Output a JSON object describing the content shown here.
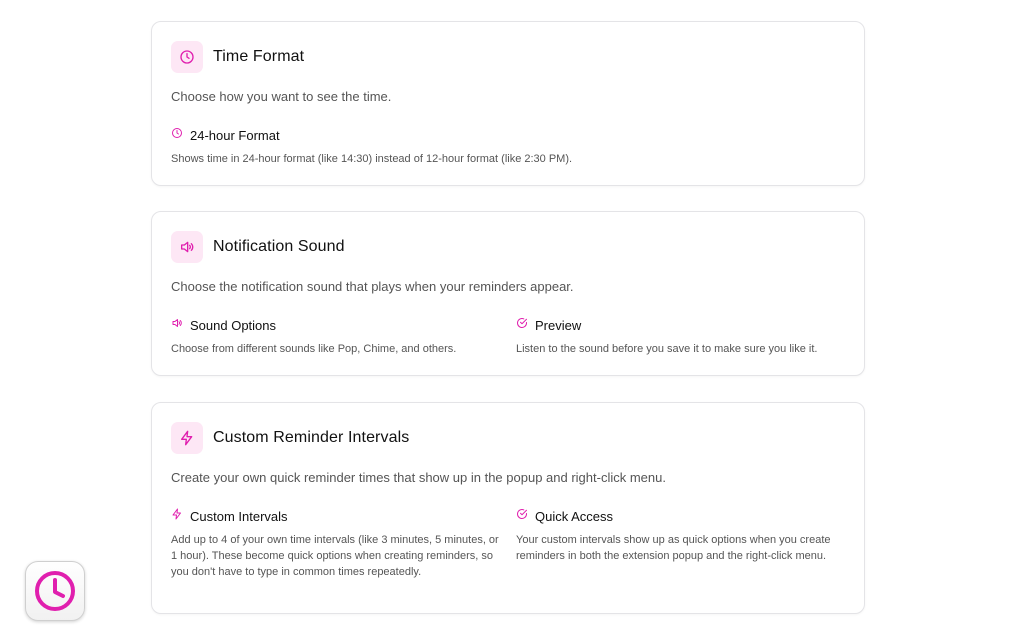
{
  "colors": {
    "accent": "#e01fae",
    "icon_bg": "#fde7f5",
    "border": "#e4e4e7"
  },
  "time_format": {
    "icon": "clock-icon",
    "title": "Time Format",
    "description": "Choose how you want to see the time.",
    "features": [
      {
        "icon": "clock-icon",
        "title": "24-hour Format",
        "description": "Shows time in 24-hour format (like 14:30) instead of 12-hour format (like 2:30 PM)."
      }
    ]
  },
  "notification_sound": {
    "icon": "speaker-icon",
    "title": "Notification Sound",
    "description": "Choose the notification sound that plays when your reminders appear.",
    "features": [
      {
        "icon": "speaker-icon",
        "title": "Sound Options",
        "description": "Choose from different sounds like Pop, Chime, and others."
      },
      {
        "icon": "check-circle-icon",
        "title": "Preview",
        "description": "Listen to the sound before you save it to make sure you like it."
      }
    ]
  },
  "custom_intervals": {
    "icon": "lightning-icon",
    "title": "Custom Reminder Intervals",
    "description": "Create your own quick reminder times that show up in the popup and right-click menu.",
    "features": [
      {
        "icon": "lightning-icon",
        "title": "Custom Intervals",
        "description": "Add up to 4 of your own time intervals (like 3 minutes, 5 minutes, or 1 hour). These become quick options when creating reminders, so you don't have to type in common times repeatedly."
      },
      {
        "icon": "check-circle-icon",
        "title": "Quick Access",
        "description": "Your custom intervals show up as quick options when you create reminders in both the extension popup and the right-click menu."
      }
    ]
  },
  "dock": {
    "icon": "clock-app-icon"
  }
}
